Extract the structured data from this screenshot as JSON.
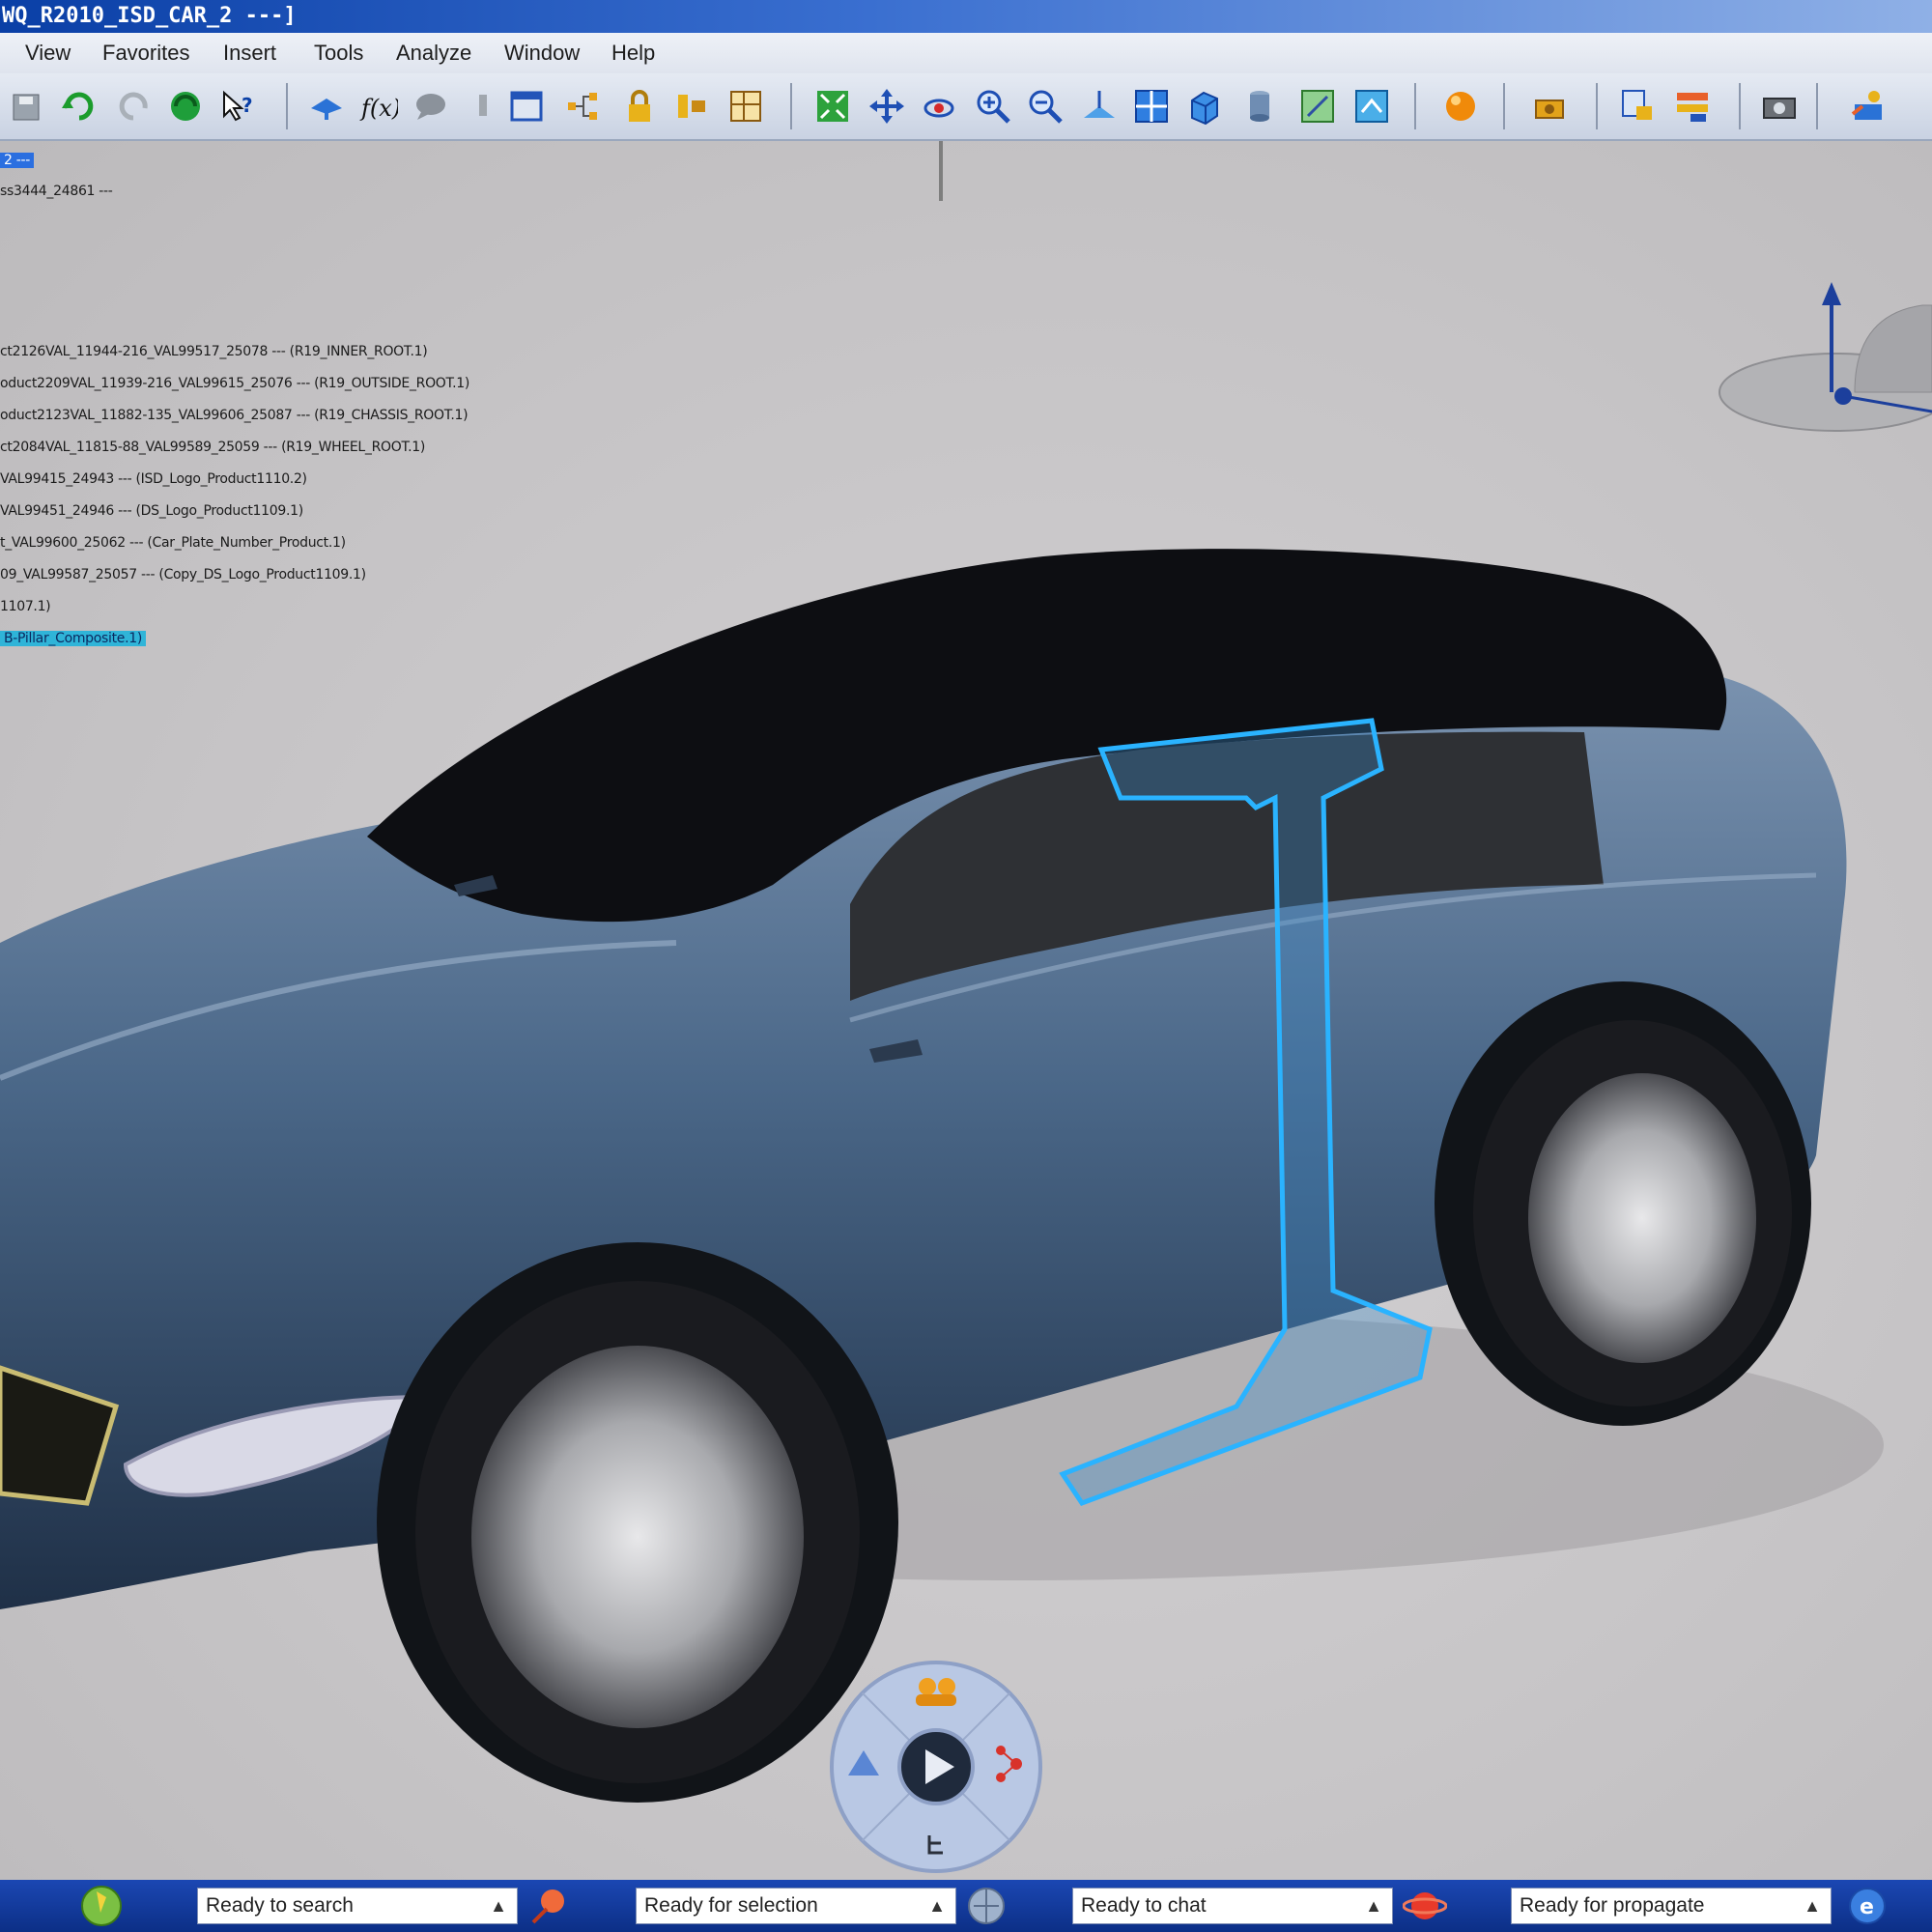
{
  "window": {
    "title": "WQ_R2010_ISD_CAR_2 ---]"
  },
  "menu": [
    {
      "label": "View"
    },
    {
      "label": "Favorites"
    },
    {
      "label": "Insert"
    },
    {
      "label": "Tools"
    },
    {
      "label": "Analyze"
    },
    {
      "label": "Window"
    },
    {
      "label": "Help"
    }
  ],
  "toolbar_icons": [
    "save-icon",
    "undo-icon",
    "redo-icon",
    "update-icon",
    "whats-this-icon",
    "hat-icon",
    "formula-icon",
    "comment-icon",
    "pin-icon",
    "catalog-icon",
    "tree-icon",
    "lock-icon",
    "measure-icon",
    "grid-icon",
    "fit-all-icon",
    "pan-icon",
    "rotate-icon",
    "zoom-in-icon",
    "zoom-out-icon",
    "normal-view-icon",
    "multi-view-icon",
    "iso-view-icon",
    "render-style-icon",
    "hide-show-icon",
    "swap-visible-icon",
    "material-sphere-icon",
    "camera-icon",
    "publish-icon",
    "compare-icon",
    "capture-icon",
    "share-icon"
  ],
  "tree": {
    "root": "2 ---",
    "items": [
      "ss3444_24861 ---",
      "ct2126VAL_11944-216_VAL99517_25078 --- (R19_INNER_ROOT.1)",
      "oduct2209VAL_11939-216_VAL99615_25076 --- (R19_OUTSIDE_ROOT.1)",
      "oduct2123VAL_11882-135_VAL99606_25087 --- (R19_CHASSIS_ROOT.1)",
      "ct2084VAL_11815-88_VAL99589_25059 --- (R19_WHEEL_ROOT.1)",
      "VAL99415_24943 --- (ISD_Logo_Product1110.2)",
      "VAL99451_24946 --- (DS_Logo_Product1109.1)",
      "t_VAL99600_25062 --- (Car_Plate_Number_Product.1)",
      "09_VAL99587_25057 --- (Copy_DS_Logo_Product1109.1)",
      "1107.1)"
    ],
    "highlighted": "B-Pillar_Composite.1)"
  },
  "statusbar": [
    {
      "label": "Ready to search"
    },
    {
      "label": "Ready for selection"
    },
    {
      "label": "Ready to chat"
    },
    {
      "label": "Ready for propagate"
    }
  ],
  "colors": {
    "body_paint": "#3f5e80",
    "glass": "#0d0e12",
    "pillar_highlight": "#2ab3ff",
    "titlebar": "#0a3fa6",
    "statusbar": "#0c2f86"
  }
}
